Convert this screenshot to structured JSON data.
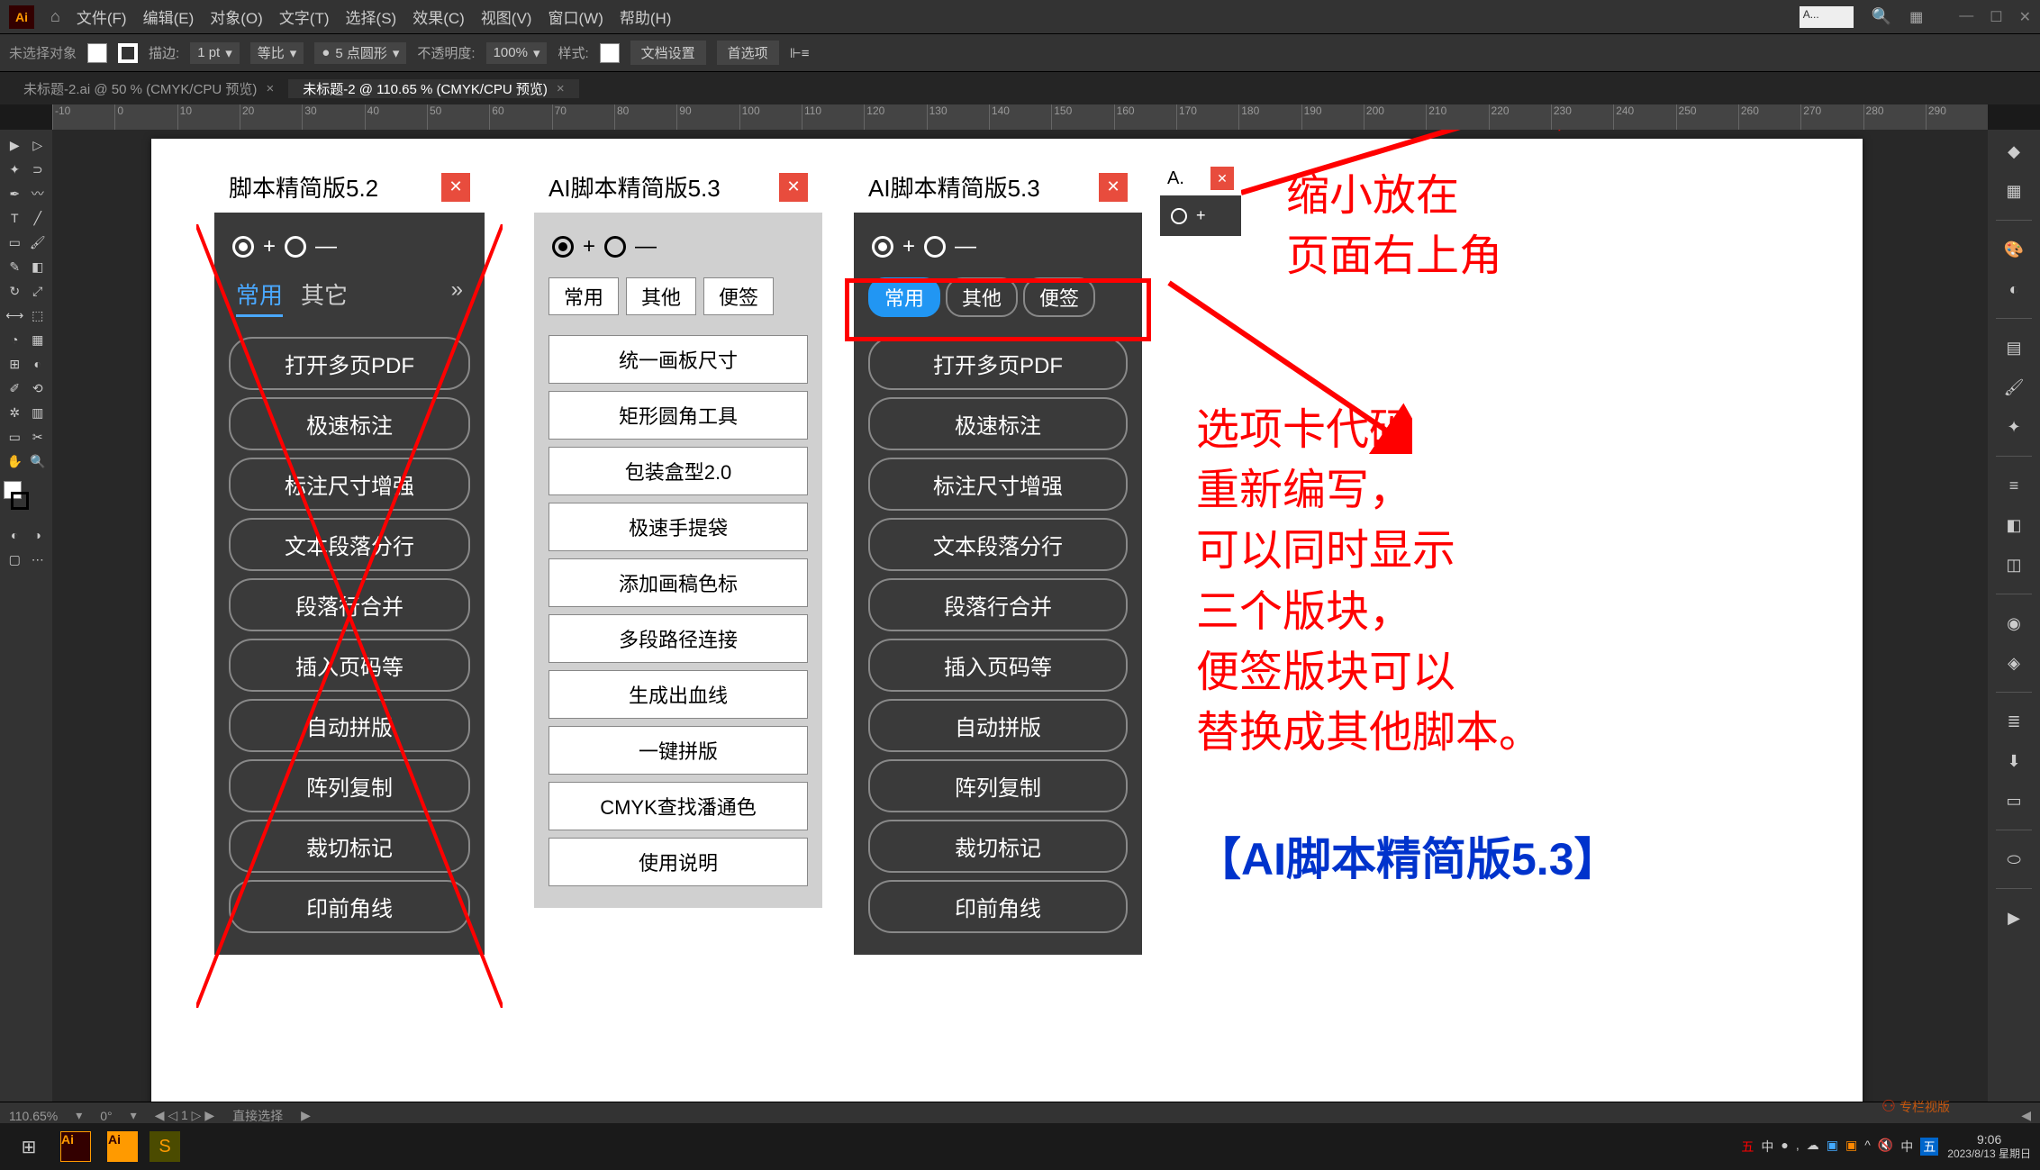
{
  "app": {
    "logo": "Ai"
  },
  "menu": [
    "文件(F)",
    "编辑(E)",
    "对象(O)",
    "文字(T)",
    "选择(S)",
    "效果(C)",
    "视图(V)",
    "窗口(W)",
    "帮助(H)"
  ],
  "controlbar": {
    "noselection": "未选择对象",
    "stroke_label": "描边:",
    "stroke_val": "1 pt",
    "uniform": "等比",
    "brush_val": "5 点圆形",
    "opacity_label": "不透明度:",
    "opacity_val": "100%",
    "style_label": "样式:",
    "doc_setup": "文档设置",
    "prefs": "首选项"
  },
  "tabs": [
    {
      "label": "未标题-2.ai @ 50 % (CMYK/CPU 预览)",
      "active": false
    },
    {
      "label": "未标题-2 @ 110.65 % (CMYK/CPU 预览)",
      "active": true
    }
  ],
  "ruler": [
    "-10",
    "0",
    "10",
    "20",
    "30",
    "40",
    "50",
    "60",
    "70",
    "80",
    "90",
    "100",
    "110",
    "120",
    "130",
    "140",
    "150",
    "160",
    "170",
    "180",
    "190",
    "200",
    "210",
    "220",
    "230",
    "240",
    "250",
    "260",
    "270",
    "280",
    "290"
  ],
  "panel52": {
    "title": "脚本精简版5.2",
    "tabs": [
      "常用",
      "其它"
    ],
    "buttons": [
      "打开多页PDF",
      "极速标注",
      "标注尺寸增强",
      "文本段落分行",
      "段落行合并",
      "插入页码等",
      "自动拼版",
      "阵列复制",
      "裁切标记",
      "印前角线"
    ]
  },
  "panel53light": {
    "title": "AI脚本精简版5.3",
    "tabs": [
      "常用",
      "其他",
      "便签"
    ],
    "buttons": [
      "统一画板尺寸",
      "矩形圆角工具",
      "包装盒型2.0",
      "极速手提袋",
      "添加画稿色标",
      "多段路径连接",
      "生成出血线",
      "一键拼版",
      "CMYK查找潘通色",
      "使用说明"
    ]
  },
  "panel53dark": {
    "title": "AI脚本精简版5.3",
    "tabs": [
      "常用",
      "其他",
      "便签"
    ],
    "buttons": [
      "打开多页PDF",
      "极速标注",
      "标注尺寸增强",
      "文本段落分行",
      "段落行合并",
      "插入页码等",
      "自动拼版",
      "阵列复制",
      "裁切标记",
      "印前角线"
    ]
  },
  "panelmini": {
    "title": "A."
  },
  "annotations": {
    "top": "缩小放在\n页面右上角",
    "mid": "选项卡代码\n重新编写，\n可以同时显示\n三个版块，\n便签版块可以\n替换成其他脚本。",
    "bottom": "【AI脚本精简版5.3】"
  },
  "status": {
    "zoom": "110.65%",
    "rotate": "0°",
    "artboard": "1",
    "tool": "直接选择"
  },
  "taskbar": {
    "time": "9:06",
    "date": "2023/8/13 星期日"
  },
  "mini_search": "A..."
}
